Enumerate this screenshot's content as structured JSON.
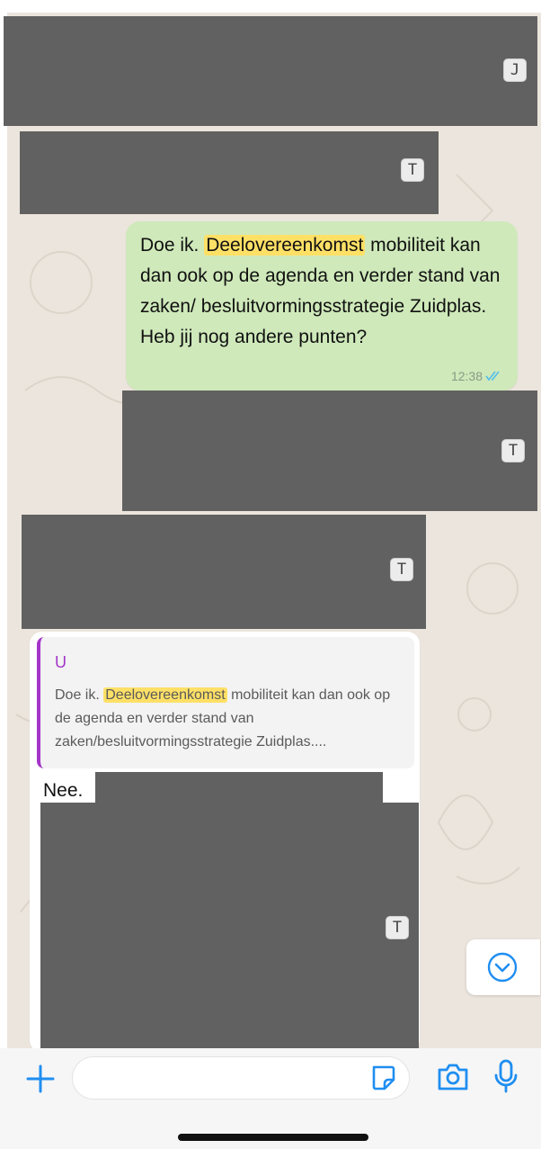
{
  "colors": {
    "chat_background": "#ebe5dd",
    "outgoing_bubble": "#cfe9ba",
    "incoming_bubble": "#ffffff",
    "highlight": "#ffe066",
    "quote_accent": "#a335c9",
    "read_ticks": "#53bdeb",
    "icon_blue": "#1f8ef1",
    "redaction": "#616161"
  },
  "redactions": [
    {
      "label": "J"
    },
    {
      "label": "T"
    },
    {
      "label": "T"
    },
    {
      "label": "T"
    },
    {
      "label": "T"
    }
  ],
  "outgoing_message": {
    "before_highlight": "Doe ik. ",
    "highlight": "Deelovereenkomst",
    "after_highlight": " mobiliteit kan dan ook op de agenda en verder stand van zaken/ besluitvormingsstrategie Zuidplas. Heb jij nog andere punten?",
    "time": "12:38",
    "status_icon": "double-check-icon"
  },
  "incoming_message": {
    "quote": {
      "author": "U",
      "before_highlight": "Doe ik. ",
      "highlight": "Deelovereenkomst",
      "after_highlight": " mobiliteit kan dan ook op de agenda en verder stand van zaken/besluitvormingsstrategie Zuidplas...."
    },
    "text": "Nee."
  },
  "composer": {
    "placeholder": "",
    "icons": [
      "plus-icon",
      "sticker-icon",
      "camera-icon",
      "microphone-icon"
    ]
  },
  "scroll_button_icon": "chevron-down-icon"
}
